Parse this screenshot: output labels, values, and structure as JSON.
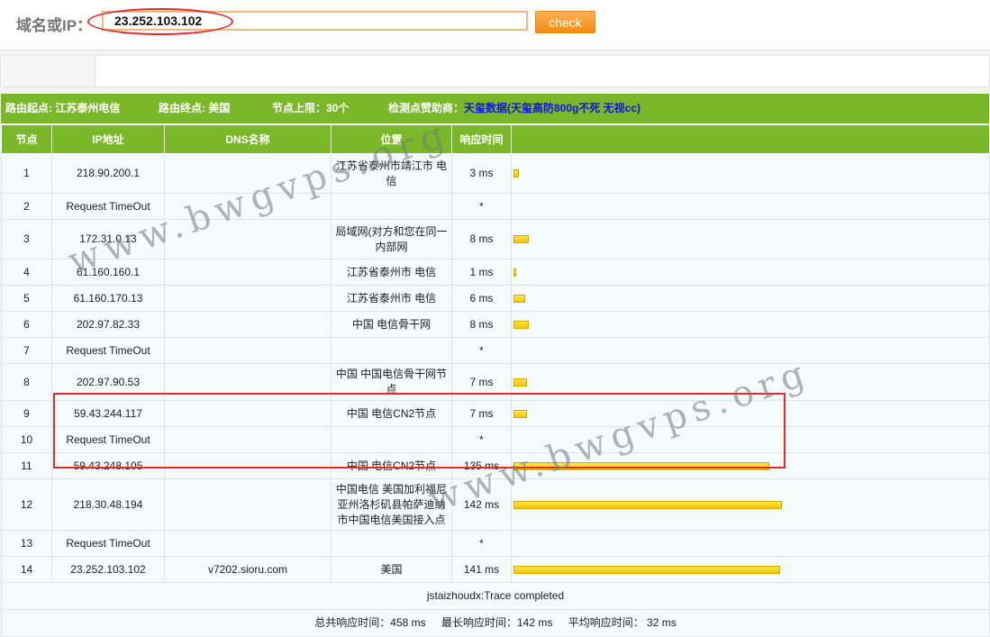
{
  "search": {
    "label": "域名或IP：",
    "value": "23.252.103.102",
    "button_label": "check"
  },
  "info": {
    "route_start": "路由起点: 江苏泰州电信",
    "route_end": "路由终点: 美国",
    "node_limit": "节点上限：30个",
    "sponsor_label": "检测点赞助商：",
    "sponsor_name": "天玺数据",
    "sponsor_detail": "(天玺高防800g不死 无视cc)"
  },
  "columns": {
    "node": "节点",
    "ip": "IP地址",
    "dns": "DNS名称",
    "location": "位置",
    "time": "响应时间"
  },
  "rows": [
    {
      "node": "1",
      "ip": "218.90.200.1",
      "dns": "",
      "location": "江苏省泰州市靖江市 电信",
      "time": "3 ms",
      "ms": 3
    },
    {
      "node": "2",
      "ip": "Request TimeOut",
      "dns": "",
      "location": "",
      "time": "*",
      "ms": null
    },
    {
      "node": "3",
      "ip": "172.31.0.13",
      "dns": "",
      "location": "局域网(对方和您在同一内部网",
      "time": "8 ms",
      "ms": 8
    },
    {
      "node": "4",
      "ip": "61.160.160.1",
      "dns": "",
      "location": "江苏省泰州市 电信",
      "time": "1 ms",
      "ms": 1
    },
    {
      "node": "5",
      "ip": "61.160.170.13",
      "dns": "",
      "location": "江苏省泰州市 电信",
      "time": "6 ms",
      "ms": 6
    },
    {
      "node": "6",
      "ip": "202.97.82.33",
      "dns": "",
      "location": "中国 电信骨干网",
      "time": "8 ms",
      "ms": 8
    },
    {
      "node": "7",
      "ip": "Request TimeOut",
      "dns": "",
      "location": "",
      "time": "*",
      "ms": null
    },
    {
      "node": "8",
      "ip": "202.97.90.53",
      "dns": "",
      "location": "中国 中国电信骨干网节点",
      "time": "7 ms",
      "ms": 7
    },
    {
      "node": "9",
      "ip": "59.43.244.117",
      "dns": "",
      "location": "中国 电信CN2节点",
      "time": "7 ms",
      "ms": 7
    },
    {
      "node": "10",
      "ip": "Request TimeOut",
      "dns": "",
      "location": "",
      "time": "*",
      "ms": null
    },
    {
      "node": "11",
      "ip": "59.43.248.105",
      "dns": "",
      "location": "中国 电信CN2节点",
      "time": "135 ms",
      "ms": 135
    },
    {
      "node": "12",
      "ip": "218.30.48.194",
      "dns": "",
      "location": "中国电信 美国加利福尼亚州洛杉矶县帕萨迪纳市中国电信美国接入点",
      "time": "142 ms",
      "ms": 142
    },
    {
      "node": "13",
      "ip": "Request TimeOut",
      "dns": "",
      "location": "",
      "time": "*",
      "ms": null
    },
    {
      "node": "14",
      "ip": "23.252.103.102",
      "dns": "v7202.sioru.com",
      "location": "美国",
      "time": "141 ms",
      "ms": 141
    }
  ],
  "trace_status": "jstaizhoudx:Trace completed",
  "summary": {
    "total": "总共响应时间：458 ms",
    "max": "最长响应时间：142 ms",
    "avg": "平均响应时间： 32 ms"
  },
  "watermark": "www.bwgvps.org",
  "colors": {
    "header_green": "#7ab829",
    "bar_yellow": "#f2c600",
    "highlight_red": "#e32b2b",
    "button_orange": "#f48a11",
    "sponsor_blue": "#0a18d6"
  }
}
